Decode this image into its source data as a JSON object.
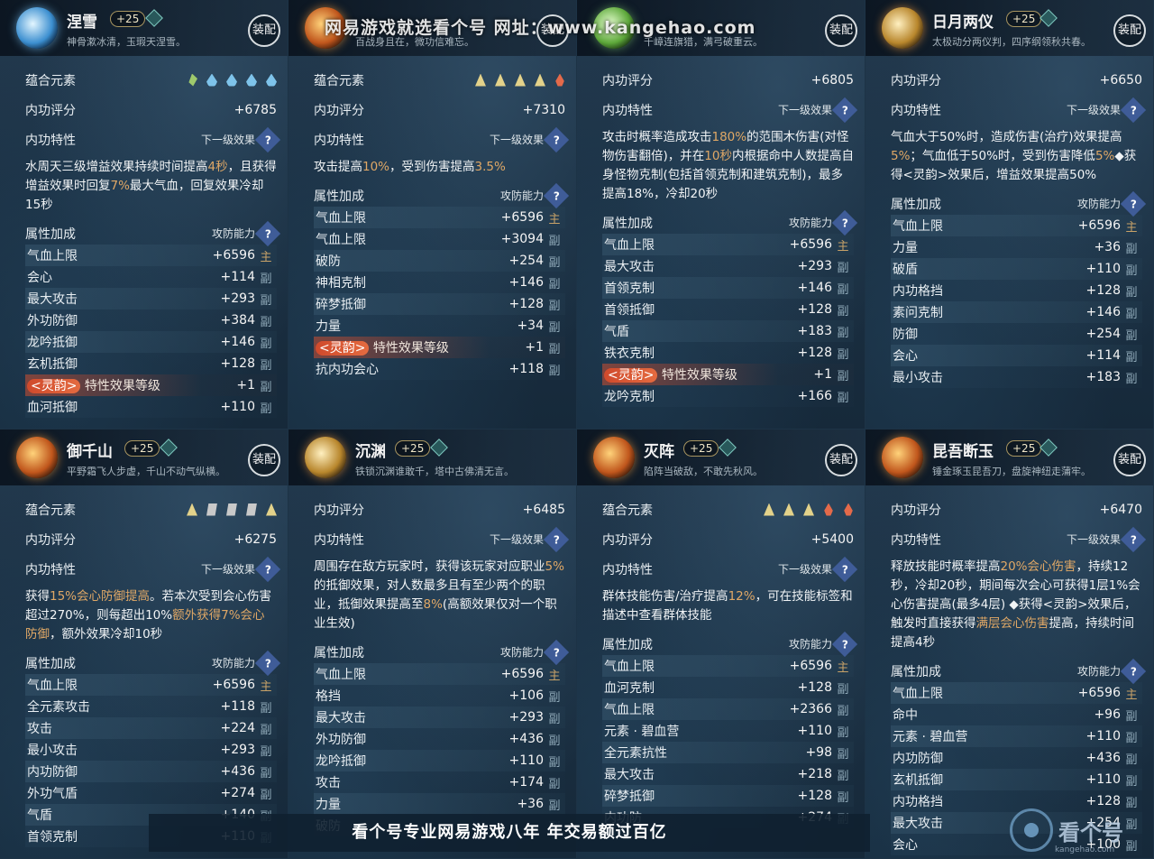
{
  "watermark_top": "网易游戏就选看个号   网址：www.kangehao.com",
  "bottom_banner": "看个号专业网易游戏八年   年交易额过百亿",
  "logo": {
    "text": "看个号",
    "sub": "kangehao.com"
  },
  "labels": {
    "elements": "蕴合元素",
    "score": "内功评分",
    "trait": "内功特性",
    "next": "下一级效果",
    "attr": "属性加成",
    "attr_right": "攻防能力",
    "equip": "装配",
    "help": "?"
  },
  "panels": [
    {
      "name": "涅雪",
      "level": "+25",
      "desc": "神骨漱冰清，玉瑕天涅雪。",
      "elements": [
        "wood",
        "water",
        "water",
        "water",
        "water"
      ],
      "score": "+6785",
      "trait": [
        "水周天三级增益效果持续时间提高",
        "4秒",
        "，且获得增益效果时回复",
        "7%",
        "最大气血，回复效果冷却15秒"
      ],
      "attrs": [
        {
          "n": "气血上限",
          "v": "+6596",
          "t": "主"
        },
        {
          "n": "会心",
          "v": "+114",
          "t": "副"
        },
        {
          "n": "最大攻击",
          "v": "+293",
          "t": "副"
        },
        {
          "n": "外功防御",
          "v": "+384",
          "t": "副"
        },
        {
          "n": "龙吟抵御",
          "v": "+146",
          "t": "副"
        },
        {
          "n": "玄机抵御",
          "v": "+128",
          "t": "副"
        },
        {
          "n": "特性效果等级",
          "v": "+1",
          "t": "副",
          "tag": "<灵韵>"
        },
        {
          "n": "血河抵御",
          "v": "+110",
          "t": "副"
        }
      ]
    },
    {
      "name": "",
      "level": "",
      "desc": "百战身且在，微功信难忘。",
      "elements": [
        "earth",
        "earth",
        "earth",
        "earth",
        "fire"
      ],
      "score": "+7310",
      "trait": [
        "攻击提高",
        "10%",
        "，受到伤害提高",
        "3.5%",
        ""
      ],
      "attrs": [
        {
          "n": "气血上限",
          "v": "+6596",
          "t": "主"
        },
        {
          "n": "气血上限",
          "v": "+3094",
          "t": "副"
        },
        {
          "n": "破防",
          "v": "+254",
          "t": "副"
        },
        {
          "n": "神相克制",
          "v": "+146",
          "t": "副"
        },
        {
          "n": "碎梦抵御",
          "v": "+128",
          "t": "副"
        },
        {
          "n": "力量",
          "v": "+34",
          "t": "副"
        },
        {
          "n": "特性效果等级",
          "v": "+1",
          "t": "副",
          "tag": "<灵韵>"
        },
        {
          "n": "抗内功会心",
          "v": "+118",
          "t": "副"
        }
      ]
    },
    {
      "name": "",
      "level": "",
      "desc": "千嶂连旗猎，满弓破重云。",
      "elements": [],
      "score": "+6805",
      "trait": [
        "攻击时概率造成攻击",
        "180%",
        "的范围木伤害(对怪物伤害翻倍)，并在",
        "10秒",
        "内根据命中人数提高自身怪物克制(包括首领克制和建筑克制)，最多提高18%，冷却20秒"
      ],
      "attrs": [
        {
          "n": "气血上限",
          "v": "+6596",
          "t": "主"
        },
        {
          "n": "最大攻击",
          "v": "+293",
          "t": "副"
        },
        {
          "n": "首领克制",
          "v": "+146",
          "t": "副"
        },
        {
          "n": "首领抵御",
          "v": "+128",
          "t": "副"
        },
        {
          "n": "气盾",
          "v": "+183",
          "t": "副"
        },
        {
          "n": "铁衣克制",
          "v": "+128",
          "t": "副"
        },
        {
          "n": "特性效果等级",
          "v": "+1",
          "t": "副",
          "tag": "<灵韵>"
        },
        {
          "n": "龙吟克制",
          "v": "+166",
          "t": "副"
        }
      ]
    },
    {
      "name": "日月两仪",
      "level": "+25",
      "desc": "太极动分两仪判，四序纲领秋共春。",
      "elements": [],
      "score": "+6650",
      "trait": [
        "气血大于50%时，造成伤害(治疗)效果提高",
        "5%",
        "；气血低于50%时，受到伤害降低",
        "5%",
        "◆获得<灵韵>效果后，增益效果提高50%"
      ],
      "attrs": [
        {
          "n": "气血上限",
          "v": "+6596",
          "t": "主"
        },
        {
          "n": "力量",
          "v": "+36",
          "t": "副"
        },
        {
          "n": "破盾",
          "v": "+110",
          "t": "副"
        },
        {
          "n": "内功格挡",
          "v": "+128",
          "t": "副"
        },
        {
          "n": "素问克制",
          "v": "+146",
          "t": "副"
        },
        {
          "n": "防御",
          "v": "+254",
          "t": "副"
        },
        {
          "n": "会心",
          "v": "+114",
          "t": "副"
        },
        {
          "n": "最小攻击",
          "v": "+183",
          "t": "副"
        }
      ]
    },
    {
      "name": "御千山",
      "level": "+25",
      "desc": "平野霜飞人步虚，千山不动气纵横。",
      "elements": [
        "earth",
        "metal",
        "metal",
        "metal",
        "earth"
      ],
      "score": "+6275",
      "trait": [
        "获得",
        "15%会心防御提高",
        "。若本次受到会心伤害超过270%，则每超出10%",
        "额外获得7%会心防御",
        "，额外效果冷却10秒"
      ],
      "attrs": [
        {
          "n": "气血上限",
          "v": "+6596",
          "t": "主"
        },
        {
          "n": "全元素攻击",
          "v": "+118",
          "t": "副"
        },
        {
          "n": "攻击",
          "v": "+224",
          "t": "副"
        },
        {
          "n": "最小攻击",
          "v": "+293",
          "t": "副"
        },
        {
          "n": "内功防御",
          "v": "+436",
          "t": "副"
        },
        {
          "n": "外功气盾",
          "v": "+274",
          "t": "副"
        },
        {
          "n": "气盾",
          "v": "+140",
          "t": "副"
        },
        {
          "n": "首领克制",
          "v": "+110",
          "t": "副"
        }
      ]
    },
    {
      "name": "沉渊",
      "level": "+25",
      "desc": "铁锁沉渊谁敢千，塔中古佛清无言。",
      "elements": [],
      "score": "+6485",
      "trait": [
        "周围存在敌方玩家时，获得该玩家对应职业",
        "5%",
        "的抵御效果，对人数最多且有至少两个的职业，抵御效果提高至",
        "8%",
        "(高额效果仅对一个职业生效)"
      ],
      "attrs": [
        {
          "n": "气血上限",
          "v": "+6596",
          "t": "主"
        },
        {
          "n": "格挡",
          "v": "+106",
          "t": "副"
        },
        {
          "n": "最大攻击",
          "v": "+293",
          "t": "副"
        },
        {
          "n": "外功防御",
          "v": "+436",
          "t": "副"
        },
        {
          "n": "龙吟抵御",
          "v": "+110",
          "t": "副"
        },
        {
          "n": "攻击",
          "v": "+174",
          "t": "副"
        },
        {
          "n": "力量",
          "v": "+36",
          "t": "副"
        },
        {
          "n": "破防",
          "v": "",
          "t": "副"
        }
      ]
    },
    {
      "name": "灭阵",
      "level": "+25",
      "desc": "陷阵当破敌，不敢先秋风。",
      "elements": [
        "earth",
        "earth",
        "earth",
        "fire",
        "fire"
      ],
      "score": "+5400",
      "trait": [
        "群体技能伤害/治疗提高",
        "12%",
        "，可在技能标签和描述中查看群体技能",
        "",
        ""
      ],
      "attrs": [
        {
          "n": "气血上限",
          "v": "+6596",
          "t": "主"
        },
        {
          "n": "血河克制",
          "v": "+128",
          "t": "副"
        },
        {
          "n": "气血上限",
          "v": "+2366",
          "t": "副"
        },
        {
          "n": "元素 · 碧血营",
          "v": "+110",
          "t": "副"
        },
        {
          "n": "全元素抗性",
          "v": "+98",
          "t": "副"
        },
        {
          "n": "最大攻击",
          "v": "+218",
          "t": "副"
        },
        {
          "n": "碎梦抵御",
          "v": "+128",
          "t": "副"
        },
        {
          "n": "内功防",
          "v": "+274",
          "t": "副"
        }
      ]
    },
    {
      "name": "昆吾断玉",
      "level": "+25",
      "desc": "锤金琢玉昆吾刀，盘旋神纽走蒲牢。",
      "elements": [],
      "score": "+6470",
      "trait": [
        "释放技能时概率提高",
        "20%会心伤害",
        "，持续12秒，冷却20秒，期间每次会心可获得1层1%会心伤害提高(最多4层) ◆获得<灵韵>效果后，触发时直接获得",
        "满层会心伤害",
        "提高，持续时间提高4秒"
      ],
      "attrs": [
        {
          "n": "气血上限",
          "v": "+6596",
          "t": "主"
        },
        {
          "n": "命中",
          "v": "+96",
          "t": "副"
        },
        {
          "n": "元素 · 碧血营",
          "v": "+110",
          "t": "副"
        },
        {
          "n": "内功防御",
          "v": "+436",
          "t": "副"
        },
        {
          "n": "玄机抵御",
          "v": "+110",
          "t": "副"
        },
        {
          "n": "内功格挡",
          "v": "+128",
          "t": "副"
        },
        {
          "n": "最大攻击",
          "v": "+254",
          "t": "副"
        },
        {
          "n": "会心",
          "v": "+100",
          "t": "副"
        }
      ]
    }
  ]
}
